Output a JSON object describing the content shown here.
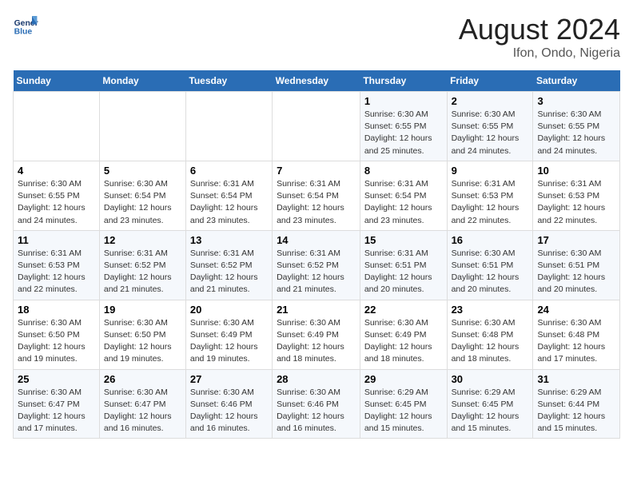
{
  "header": {
    "logo_general": "General",
    "logo_blue": "Blue",
    "month_title": "August 2024",
    "location": "Ifon, Ondo, Nigeria"
  },
  "weekdays": [
    "Sunday",
    "Monday",
    "Tuesday",
    "Wednesday",
    "Thursday",
    "Friday",
    "Saturday"
  ],
  "weeks": [
    [
      {
        "day": "",
        "detail": ""
      },
      {
        "day": "",
        "detail": ""
      },
      {
        "day": "",
        "detail": ""
      },
      {
        "day": "",
        "detail": ""
      },
      {
        "day": "1",
        "detail": "Sunrise: 6:30 AM\nSunset: 6:55 PM\nDaylight: 12 hours\nand 25 minutes."
      },
      {
        "day": "2",
        "detail": "Sunrise: 6:30 AM\nSunset: 6:55 PM\nDaylight: 12 hours\nand 24 minutes."
      },
      {
        "day": "3",
        "detail": "Sunrise: 6:30 AM\nSunset: 6:55 PM\nDaylight: 12 hours\nand 24 minutes."
      }
    ],
    [
      {
        "day": "4",
        "detail": "Sunrise: 6:30 AM\nSunset: 6:55 PM\nDaylight: 12 hours\nand 24 minutes."
      },
      {
        "day": "5",
        "detail": "Sunrise: 6:30 AM\nSunset: 6:54 PM\nDaylight: 12 hours\nand 23 minutes."
      },
      {
        "day": "6",
        "detail": "Sunrise: 6:31 AM\nSunset: 6:54 PM\nDaylight: 12 hours\nand 23 minutes."
      },
      {
        "day": "7",
        "detail": "Sunrise: 6:31 AM\nSunset: 6:54 PM\nDaylight: 12 hours\nand 23 minutes."
      },
      {
        "day": "8",
        "detail": "Sunrise: 6:31 AM\nSunset: 6:54 PM\nDaylight: 12 hours\nand 23 minutes."
      },
      {
        "day": "9",
        "detail": "Sunrise: 6:31 AM\nSunset: 6:53 PM\nDaylight: 12 hours\nand 22 minutes."
      },
      {
        "day": "10",
        "detail": "Sunrise: 6:31 AM\nSunset: 6:53 PM\nDaylight: 12 hours\nand 22 minutes."
      }
    ],
    [
      {
        "day": "11",
        "detail": "Sunrise: 6:31 AM\nSunset: 6:53 PM\nDaylight: 12 hours\nand 22 minutes."
      },
      {
        "day": "12",
        "detail": "Sunrise: 6:31 AM\nSunset: 6:52 PM\nDaylight: 12 hours\nand 21 minutes."
      },
      {
        "day": "13",
        "detail": "Sunrise: 6:31 AM\nSunset: 6:52 PM\nDaylight: 12 hours\nand 21 minutes."
      },
      {
        "day": "14",
        "detail": "Sunrise: 6:31 AM\nSunset: 6:52 PM\nDaylight: 12 hours\nand 21 minutes."
      },
      {
        "day": "15",
        "detail": "Sunrise: 6:31 AM\nSunset: 6:51 PM\nDaylight: 12 hours\nand 20 minutes."
      },
      {
        "day": "16",
        "detail": "Sunrise: 6:30 AM\nSunset: 6:51 PM\nDaylight: 12 hours\nand 20 minutes."
      },
      {
        "day": "17",
        "detail": "Sunrise: 6:30 AM\nSunset: 6:51 PM\nDaylight: 12 hours\nand 20 minutes."
      }
    ],
    [
      {
        "day": "18",
        "detail": "Sunrise: 6:30 AM\nSunset: 6:50 PM\nDaylight: 12 hours\nand 19 minutes."
      },
      {
        "day": "19",
        "detail": "Sunrise: 6:30 AM\nSunset: 6:50 PM\nDaylight: 12 hours\nand 19 minutes."
      },
      {
        "day": "20",
        "detail": "Sunrise: 6:30 AM\nSunset: 6:49 PM\nDaylight: 12 hours\nand 19 minutes."
      },
      {
        "day": "21",
        "detail": "Sunrise: 6:30 AM\nSunset: 6:49 PM\nDaylight: 12 hours\nand 18 minutes."
      },
      {
        "day": "22",
        "detail": "Sunrise: 6:30 AM\nSunset: 6:49 PM\nDaylight: 12 hours\nand 18 minutes."
      },
      {
        "day": "23",
        "detail": "Sunrise: 6:30 AM\nSunset: 6:48 PM\nDaylight: 12 hours\nand 18 minutes."
      },
      {
        "day": "24",
        "detail": "Sunrise: 6:30 AM\nSunset: 6:48 PM\nDaylight: 12 hours\nand 17 minutes."
      }
    ],
    [
      {
        "day": "25",
        "detail": "Sunrise: 6:30 AM\nSunset: 6:47 PM\nDaylight: 12 hours\nand 17 minutes."
      },
      {
        "day": "26",
        "detail": "Sunrise: 6:30 AM\nSunset: 6:47 PM\nDaylight: 12 hours\nand 16 minutes."
      },
      {
        "day": "27",
        "detail": "Sunrise: 6:30 AM\nSunset: 6:46 PM\nDaylight: 12 hours\nand 16 minutes."
      },
      {
        "day": "28",
        "detail": "Sunrise: 6:30 AM\nSunset: 6:46 PM\nDaylight: 12 hours\nand 16 minutes."
      },
      {
        "day": "29",
        "detail": "Sunrise: 6:29 AM\nSunset: 6:45 PM\nDaylight: 12 hours\nand 15 minutes."
      },
      {
        "day": "30",
        "detail": "Sunrise: 6:29 AM\nSunset: 6:45 PM\nDaylight: 12 hours\nand 15 minutes."
      },
      {
        "day": "31",
        "detail": "Sunrise: 6:29 AM\nSunset: 6:44 PM\nDaylight: 12 hours\nand 15 minutes."
      }
    ]
  ]
}
